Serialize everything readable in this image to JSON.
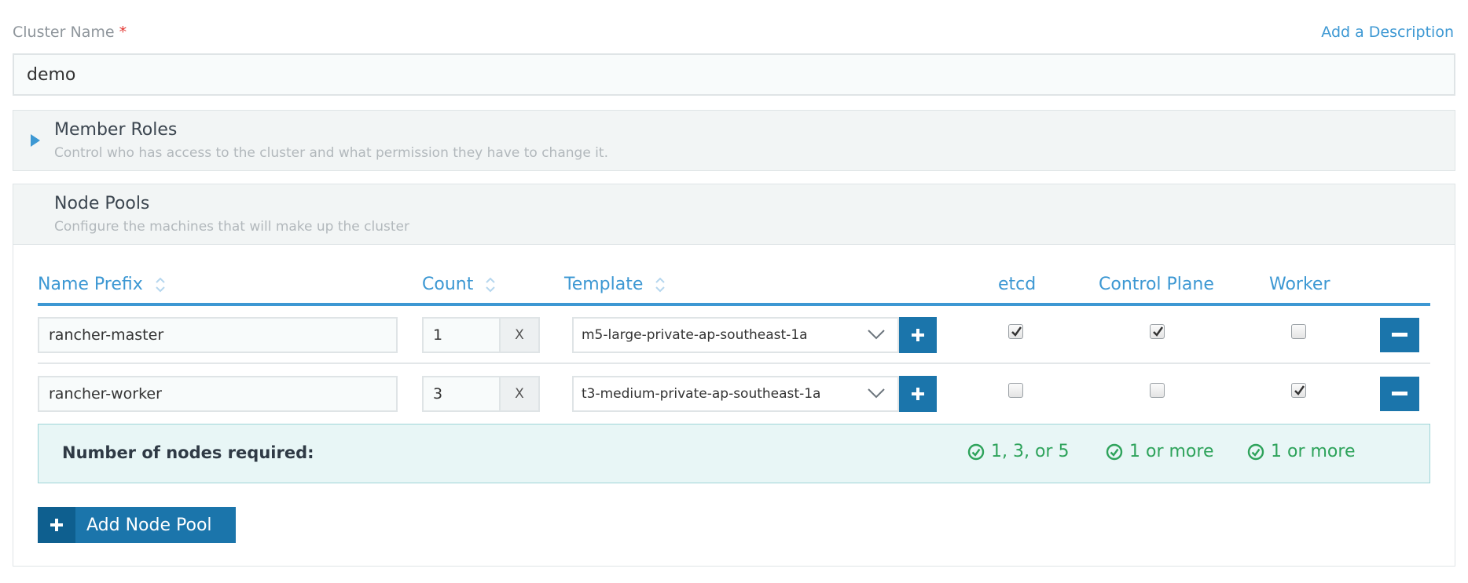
{
  "cluster_name": {
    "label": "Cluster Name",
    "required_mark": "*",
    "add_description": "Add a Description",
    "value": "demo"
  },
  "member_roles": {
    "title": "Member Roles",
    "description": "Control who has access to the cluster and what permission they have to change it."
  },
  "node_pools": {
    "title": "Node Pools",
    "description": "Configure the machines that will make up the cluster",
    "headers": {
      "name_prefix": "Name Prefix",
      "count": "Count",
      "template": "Template",
      "etcd": "etcd",
      "control_plane": "Control Plane",
      "worker": "Worker"
    },
    "rows": [
      {
        "name_prefix": "rancher-master",
        "count": "1",
        "multiplier": "X",
        "template": "m5-large-private-ap-southeast-1a",
        "etcd": true,
        "control_plane": true,
        "worker": false
      },
      {
        "name_prefix": "rancher-worker",
        "count": "3",
        "multiplier": "X",
        "template": "t3-medium-private-ap-southeast-1a",
        "etcd": false,
        "control_plane": false,
        "worker": true
      }
    ],
    "summary": {
      "label": "Number of nodes required:",
      "etcd": "1, 3, or 5",
      "control_plane": "1 or more",
      "worker": "1 or more"
    },
    "add_button": "Add Node Pool"
  },
  "colors": {
    "accent": "#3d98d3",
    "button": "#1b75ab",
    "success": "#2ea35b"
  },
  "icons": {
    "caret": "caret-right-icon",
    "sort": "sort-icon",
    "chevron": "chevron-down-icon",
    "plus": "plus-icon",
    "minus": "minus-icon",
    "check_circle": "check-circle-icon"
  }
}
